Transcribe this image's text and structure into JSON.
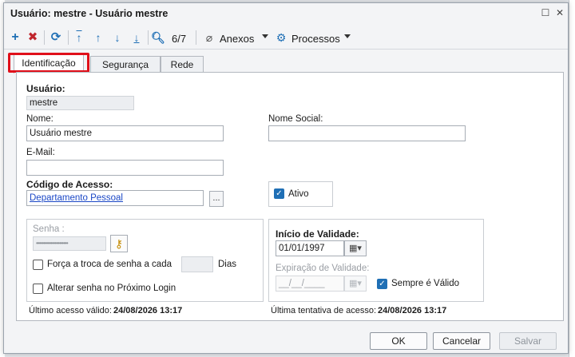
{
  "window": {
    "title": "Usuário: mestre - Usuário mestre"
  },
  "toolbar": {
    "record_position": "6/7",
    "attachments_label": "Anexos",
    "processes_label": "Processos"
  },
  "tabs": [
    {
      "label": "Identificação",
      "active": true
    },
    {
      "label": "Segurança",
      "active": false
    },
    {
      "label": "Rede",
      "active": false
    }
  ],
  "form": {
    "user_label": "Usuário:",
    "user_value": "mestre",
    "name_label": "Nome:",
    "name_value": "Usuário mestre",
    "social_name_label": "Nome Social:",
    "social_name_value": "",
    "email_label": "E-Mail:",
    "email_value": "",
    "access_code_label": "Código de Acesso:",
    "access_code_value": "Departamento Pessoal",
    "lookup_button": "...",
    "active_label": "Ativo",
    "active_checked": true
  },
  "password": {
    "label": "Senha :",
    "value": "••••••••••••••••••••••",
    "force_change_label": "Força a troca de senha a cada",
    "days_value": "",
    "days_label": "Dias",
    "change_next_login_label": "Alterar senha no Próximo Login"
  },
  "validity": {
    "start_label": "Início de Validade:",
    "start_value": "01/01/1997",
    "expiration_label": "Expiração de Validade:",
    "expiration_value": "__/__/____",
    "always_valid_label": "Sempre é Válido",
    "always_valid_checked": true
  },
  "status": {
    "last_access_label": "Último acesso válido:",
    "last_access_value": "24/08/2026 13:17",
    "last_attempt_label": "Última tentativa de acesso:",
    "last_attempt_value": "24/08/2026 13:17"
  },
  "footer": {
    "ok_label": "OK",
    "cancel_label": "Cancelar",
    "save_label": "Salvar"
  },
  "colors": {
    "accent": "#1f6fb5",
    "highlight": "#e0101a",
    "delete": "#c0262d"
  }
}
